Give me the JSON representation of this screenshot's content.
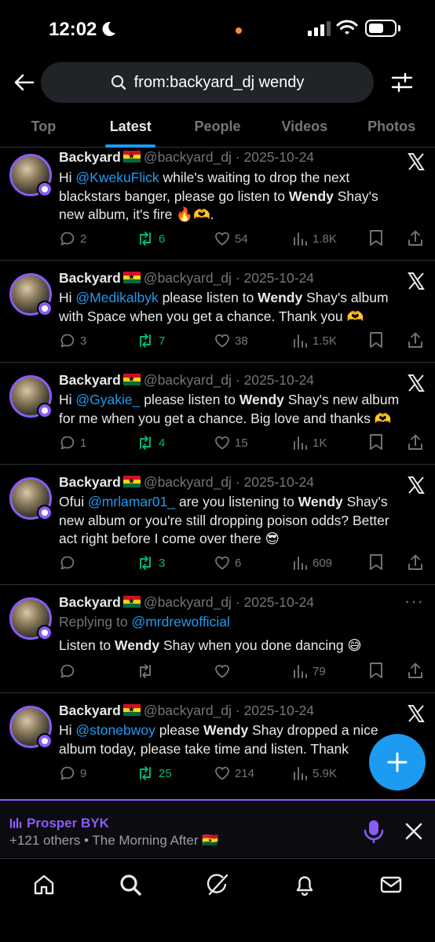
{
  "status_bar": {
    "time": "12:02"
  },
  "search": {
    "query": "from:backyard_dj wendy"
  },
  "tabs": [
    {
      "label": "Top",
      "active": false
    },
    {
      "label": "Latest",
      "active": true
    },
    {
      "label": "People",
      "active": false
    },
    {
      "label": "Videos",
      "active": false
    },
    {
      "label": "Photos",
      "active": false
    }
  ],
  "tweets": [
    {
      "name": "Backyard",
      "handle": "@backyard_dj",
      "date": "2025-10-24",
      "text_parts": [
        "Hi ",
        "@KwekuFlick",
        " while's waiting to drop the next blackstars banger, please go listen to ",
        "Wendy",
        " Shay's new album, it's fire 🔥🫶."
      ],
      "replies": "2",
      "reposts": "6",
      "likes": "54",
      "views": "1.8K"
    },
    {
      "name": "Backyard",
      "handle": "@backyard_dj",
      "date": "2025-10-24",
      "text_parts": [
        "Hi ",
        "@Medikalbyk",
        " please listen to ",
        "Wendy",
        " Shay's album with Space when you get a chance. Thank you 🫶"
      ],
      "replies": "3",
      "reposts": "7",
      "likes": "38",
      "views": "1.5K"
    },
    {
      "name": "Backyard",
      "handle": "@backyard_dj",
      "date": "2025-10-24",
      "text_parts": [
        "Hi ",
        "@Gyakie_",
        "  please listen to ",
        "Wendy",
        " Shay's new album for me when you get a chance. Big love and thanks 🫶"
      ],
      "replies": "1",
      "reposts": "4",
      "likes": "15",
      "views": "1K"
    },
    {
      "name": "Backyard",
      "handle": "@backyard_dj",
      "date": "2025-10-24",
      "text_parts": [
        "Ofui ",
        "@mrlamar01_",
        " are you listening to ",
        "Wendy",
        " Shay's new album or you're still dropping poison odds? Better act right before I come over there 😎"
      ],
      "replies": "",
      "reposts": "3",
      "likes": "6",
      "views": "609"
    },
    {
      "name": "Backyard",
      "handle": "@backyard_dj",
      "date": "2025-10-24",
      "replying_label": "Replying to",
      "replying_to": "@mrdrewofficial",
      "text_parts": [
        "Listen to ",
        "Wendy",
        " Shay when you done dancing 😅"
      ],
      "replies": "",
      "reposts": "",
      "likes": "",
      "views": "79"
    },
    {
      "name": "Backyard",
      "handle": "@backyard_dj",
      "date": "2025-10-24",
      "text_parts": [
        "Hi ",
        "@stonebwoy",
        " please ",
        "Wendy",
        " Shay dropped a nice album today, please take time and listen. Thank"
      ],
      "replies": "9",
      "reposts": "25",
      "likes": "214",
      "views": "5.9K"
    }
  ],
  "space": {
    "host": "Prosper BYK",
    "subtitle": "+121 others • The Morning After 🇬🇭"
  },
  "colors": {
    "accent": "#1d9bf0",
    "repost": "#00ba7c",
    "space": "#8a5cf6",
    "muted": "#71767b"
  }
}
